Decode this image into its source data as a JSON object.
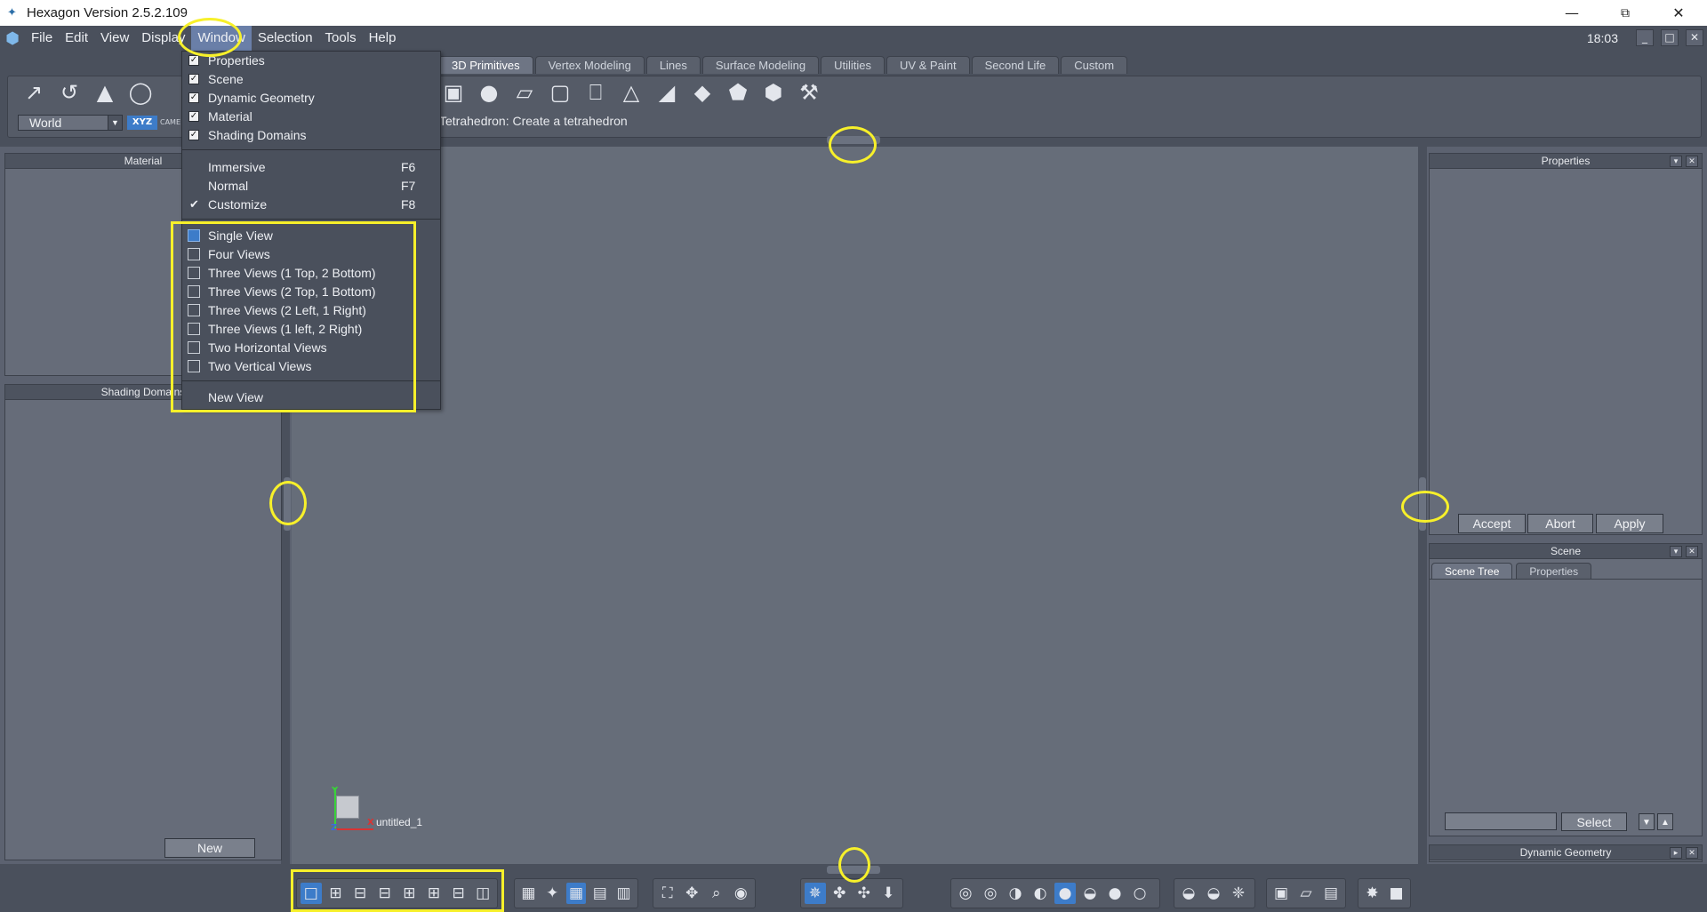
{
  "window": {
    "title": "Hexagon Version 2.5.2.109",
    "minimize": "—",
    "restore": "⧉",
    "close": "✕"
  },
  "menubar": {
    "items": [
      "File",
      "Edit",
      "View",
      "Display",
      "Window",
      "Selection",
      "Tools",
      "Help"
    ],
    "clock": "18:03"
  },
  "mdi": {
    "minimize": "_",
    "restore": "□",
    "close": "✕"
  },
  "toolbar": {
    "tabs": [
      "3D Primitives",
      "Vertex Modeling",
      "Lines",
      "Surface Modeling",
      "Utilities",
      "UV & Paint",
      "Second Life",
      "Custom"
    ],
    "active_tab": "3D Primitives",
    "status": "Tetrahedron: Create a tetrahedron",
    "coord_system": "World",
    "xyz_label": "XYZ",
    "cam_label": "CAME"
  },
  "window_menu": {
    "panels": [
      "Properties",
      "Scene",
      "Dynamic Geometry",
      "Material",
      "Shading Domains"
    ],
    "modes": [
      {
        "label": "Immersive",
        "shortcut": "F6"
      },
      {
        "label": "Normal",
        "shortcut": "F7"
      },
      {
        "label": "Customize",
        "shortcut": "F8"
      }
    ],
    "views": [
      "Single View",
      "Four Views",
      "Three Views (1 Top, 2 Bottom)",
      "Three Views (2 Top, 1 Bottom)",
      "Three Views (2 Left, 1 Right)",
      "Three Views (1 left, 2 Right)",
      "Two Horizontal Views",
      "Two Vertical Views"
    ],
    "new_view": "New View"
  },
  "left_panels": {
    "material_title": "Material",
    "shading_title": "Shading Domains",
    "new_button": "New"
  },
  "right_panels": {
    "properties_title": "Properties",
    "accept": "Accept",
    "abort": "Abort",
    "apply": "Apply",
    "scene_title": "Scene",
    "scene_tabs": [
      "Scene Tree",
      "Properties"
    ],
    "select_button": "Select",
    "dynamic_geometry_title": "Dynamic Geometry"
  },
  "viewport": {
    "object_label": "untitled_1",
    "axis_x": "X",
    "axis_y": "Y",
    "axis_z": "Z"
  },
  "icons": {
    "toolbar_left": [
      "pointer-icon",
      "lasso-icon",
      "triangle-icon",
      "sphere-ring-icon",
      "cone-tool-icon"
    ],
    "primitives": [
      "cube-icon",
      "sphere-icon",
      "plane-icon",
      "box-wire-icon",
      "cylinder-icon",
      "cone-icon",
      "tetrahedron-icon",
      "pyramid-icon",
      "dodecahedron-icon",
      "icosahedron-icon",
      "hammer-icon"
    ]
  },
  "highlight_color": "#f7f02a",
  "accent_color": "#3d7cc9"
}
